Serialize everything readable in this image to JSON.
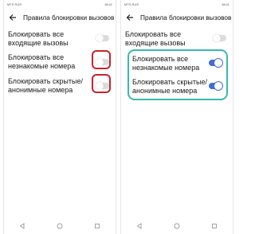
{
  "left": {
    "status": {
      "carrier": "MTS RUS",
      "time": "18:41"
    },
    "title": "Правила блокировки вызовов",
    "rows": [
      {
        "label": "Блокировать все входящие вызовы",
        "state": "off"
      },
      {
        "label": "Блокировать все незнакомые номера",
        "state": "off"
      },
      {
        "label": "Блокировать скрытые/ анонимные номера",
        "state": "off"
      }
    ]
  },
  "right": {
    "status": {
      "carrier": "MTS RUS",
      "time": "18:41"
    },
    "title": "Правила блокировки вызовов",
    "rows": [
      {
        "label": "Блокировать все входящие вызовы",
        "state": "off"
      },
      {
        "label": "Блокировать все незнакомые номера",
        "state": "on"
      },
      {
        "label": "Блокировать скрытые/ анонимные номера",
        "state": "on"
      }
    ]
  },
  "colors": {
    "accent": "#3f6fd1",
    "highlight_red": "#c8232c",
    "highlight_teal": "#38b9b0"
  },
  "icons": [
    "back-arrow-icon",
    "nav-back-icon",
    "nav-home-icon",
    "nav-recents-icon"
  ]
}
